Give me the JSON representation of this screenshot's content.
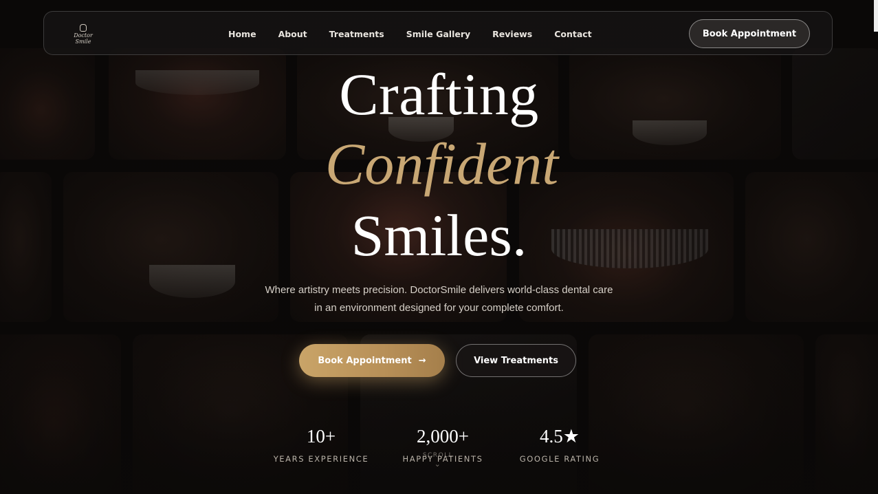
{
  "brand": {
    "logo_text": "Doctor Smile"
  },
  "nav": {
    "links": [
      "Home",
      "About",
      "Treatments",
      "Smile Gallery",
      "Reviews",
      "Contact"
    ],
    "cta": "Book Appointment"
  },
  "hero": {
    "line1": "Crafting",
    "line2": "Confident",
    "line3": "Smiles.",
    "subtitle_line1": "Where artistry meets precision. DoctorSmile delivers world-class dental care",
    "subtitle_line2": "in an environment designed for your complete comfort.",
    "primary_button": "Book Appointment",
    "primary_button_icon": "→",
    "secondary_button": "View Treatments"
  },
  "stats": [
    {
      "value": "10+",
      "label": "YEARS EXPERIENCE"
    },
    {
      "value": "2,000+",
      "label": "HAPPY PATIENTS"
    },
    {
      "value": "4.5★",
      "label": "GOOGLE RATING"
    }
  ],
  "scroll": {
    "label": "SCROLL",
    "icon": "⌄"
  },
  "colors": {
    "accent_gold": "#c8a774",
    "background": "#0b0908"
  }
}
